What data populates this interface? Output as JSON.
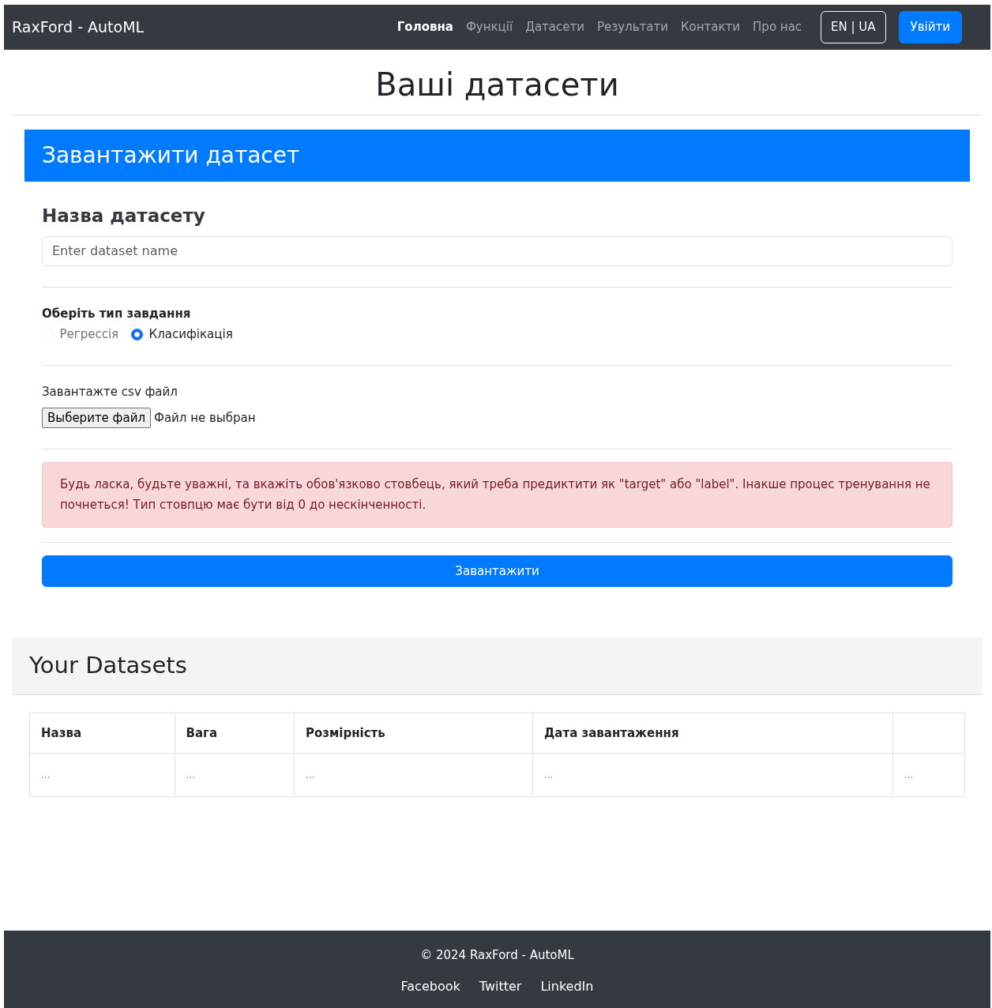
{
  "navbar": {
    "brand": "RaxFord - AutoML",
    "links": [
      {
        "label": "Головна",
        "selected": true
      },
      {
        "label": "Функції",
        "selected": false
      },
      {
        "label": "Датасети",
        "selected": false
      },
      {
        "label": "Результати",
        "selected": false
      },
      {
        "label": "Контакти",
        "selected": false
      },
      {
        "label": "Про нас",
        "selected": false
      }
    ],
    "language_button": "EN | UA",
    "login_button": "Увійти"
  },
  "page_title": "Ваші датасети",
  "upload_card": {
    "header": "Завантажити датасет",
    "name_label": "Назва датасету",
    "name_field": {
      "placeholder": "Enter dataset name"
    },
    "task_label": "Оберіть тип завдання",
    "task_options": [
      {
        "label": "Регрессія",
        "selected": false,
        "disabled": true
      },
      {
        "label": "Класифікація",
        "selected": true,
        "disabled": false
      }
    ],
    "file_label": "Завантажте csv файл",
    "file_button": "Выберите файл",
    "file_status": "Файл не выбран",
    "alert": "Будь ласка, будьте уважні, та вкажіть обов'язково стовбець, який треба предиктити як \"target\" або \"label\". Інакше процес тренування не почнеться! Тип стовпцю має бути від 0 до нескінченності.",
    "submit_button": "Завантажити"
  },
  "datasets": {
    "title": "Your Datasets",
    "table": {
      "columns": [
        "Назва",
        "Вага",
        "Розмірність",
        "Дата завантаження",
        ""
      ],
      "rows": [
        [
          "...",
          "...",
          "...",
          "...",
          "..."
        ]
      ]
    }
  },
  "footer": {
    "copyright": "© 2024 RaxFord - AutoML",
    "links": [
      "Facebook",
      "Twitter",
      "LinkedIn"
    ]
  }
}
